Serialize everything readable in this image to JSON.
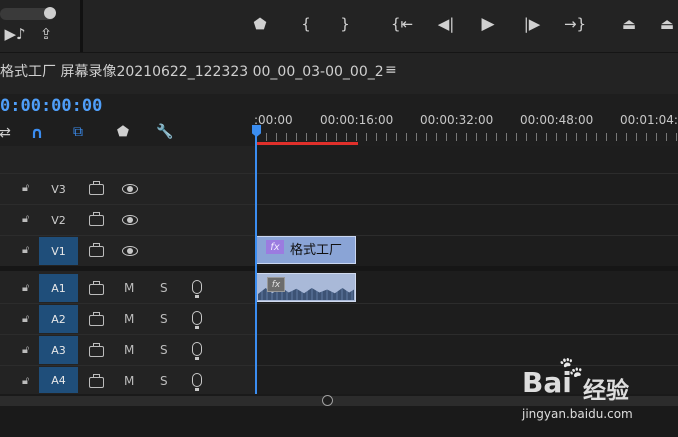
{
  "monitor": {
    "controls": [
      {
        "name": "add-marker-button",
        "glyph": "⬟"
      },
      {
        "name": "mark-in-button",
        "glyph": "{"
      },
      {
        "name": "mark-out-button",
        "glyph": "}"
      },
      {
        "name": "go-to-in-button",
        "glyph": "{⇤"
      },
      {
        "name": "step-back-button",
        "glyph": "◀|"
      },
      {
        "name": "play-button",
        "glyph": "▶"
      },
      {
        "name": "step-forward-button",
        "glyph": "|▶"
      },
      {
        "name": "go-to-out-button",
        "glyph": "→}"
      },
      {
        "name": "lift-button",
        "glyph": "⏏"
      },
      {
        "name": "extract-button",
        "glyph": "⏏"
      }
    ],
    "left_icons": [
      "▶♪",
      "⇪"
    ]
  },
  "sequence": {
    "title": "格式工厂 屏幕录像20210622_122323 00_00_03-00_00_2",
    "menu_glyph": "≡",
    "timecode": "0:00:00:00",
    "tools": [
      "⇄",
      "∩",
      "⧉",
      "⬟",
      "🔧"
    ]
  },
  "ruler": {
    "labels": [
      ":00:00",
      "00:00:16:00",
      "00:00:32:00",
      "00:00:48:00",
      "00:01:04:"
    ]
  },
  "tracks": {
    "video": [
      {
        "label": "V3",
        "active": false
      },
      {
        "label": "V2",
        "active": false
      },
      {
        "label": "V1",
        "active": true
      }
    ],
    "audio": [
      {
        "label": "A1",
        "mute": "M",
        "solo": "S"
      },
      {
        "label": "A2",
        "mute": "M",
        "solo": "S"
      },
      {
        "label": "A3",
        "mute": "M",
        "solo": "S"
      },
      {
        "label": "A4",
        "mute": "M",
        "solo": "S"
      }
    ]
  },
  "clips": {
    "video_clip_name": "格式工厂",
    "fx_label": "fx"
  },
  "watermark": {
    "brand": "Bai",
    "brand_cn": "经验",
    "url": "jingyan.baidu.com"
  },
  "colors": {
    "accent": "#3b8df0",
    "timecode": "#4f9ef8",
    "video_clip": "#8aa4d6",
    "audio_clip": "#a9b9d8",
    "work_area": "#e0302b"
  }
}
